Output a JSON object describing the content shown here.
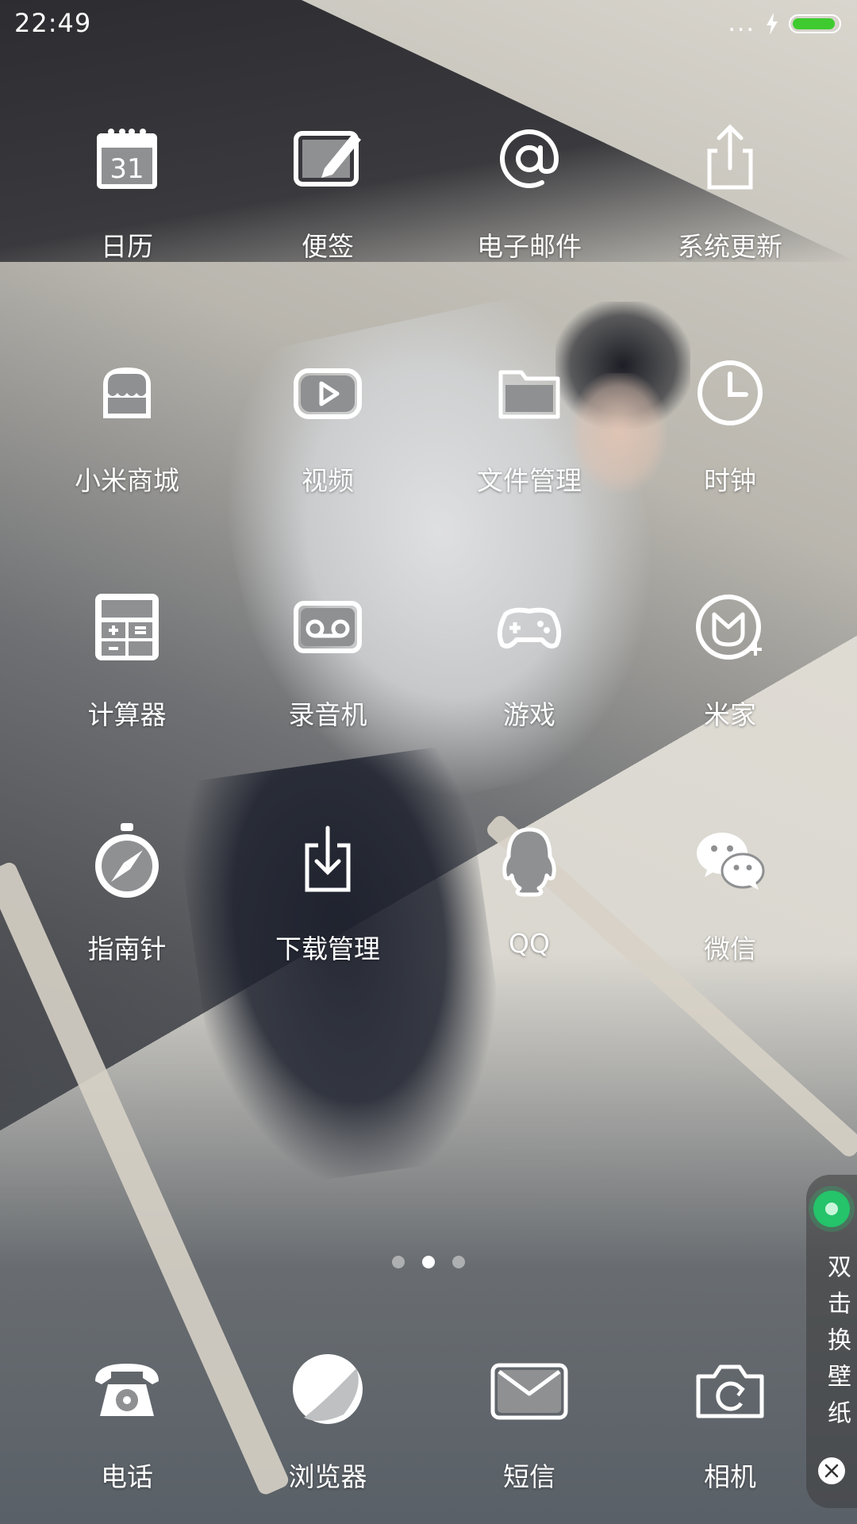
{
  "status_bar": {
    "time": "22:49",
    "signal_dots": "...",
    "battery_level": 0.95,
    "icons": [
      "charging-icon",
      "battery-icon"
    ]
  },
  "apps": [
    {
      "label": "日历",
      "icon": "calendar-icon",
      "calendar_day": "31"
    },
    {
      "label": "便签",
      "icon": "notes-icon"
    },
    {
      "label": "电子邮件",
      "icon": "email-icon"
    },
    {
      "label": "系统更新",
      "icon": "system-update-icon"
    },
    {
      "label": "小米商城",
      "icon": "mi-store-icon"
    },
    {
      "label": "视频",
      "icon": "video-icon"
    },
    {
      "label": "文件管理",
      "icon": "file-manager-icon"
    },
    {
      "label": "时钟",
      "icon": "clock-icon"
    },
    {
      "label": "计算器",
      "icon": "calculator-icon"
    },
    {
      "label": "录音机",
      "icon": "recorder-icon"
    },
    {
      "label": "游戏",
      "icon": "game-icon"
    },
    {
      "label": "米家",
      "icon": "mijia-icon"
    },
    {
      "label": "指南针",
      "icon": "compass-icon"
    },
    {
      "label": "下载管理",
      "icon": "download-icon"
    },
    {
      "label": "QQ",
      "icon": "qq-icon"
    },
    {
      "label": "微信",
      "icon": "wechat-icon"
    }
  ],
  "dock": [
    {
      "label": "电话",
      "icon": "phone-icon"
    },
    {
      "label": "浏览器",
      "icon": "browser-icon"
    },
    {
      "label": "短信",
      "icon": "messages-icon"
    },
    {
      "label": "相机",
      "icon": "camera-icon"
    }
  ],
  "page_indicator": {
    "count": 3,
    "active": 2
  },
  "wallpaper_panel": {
    "text": "双击换壁纸",
    "icons": [
      "wallpaper-dot-icon",
      "close-icon"
    ]
  },
  "colors": {
    "battery": "#3fcb2f",
    "panel_dot": "#25c36a",
    "text": "#ffffff"
  }
}
